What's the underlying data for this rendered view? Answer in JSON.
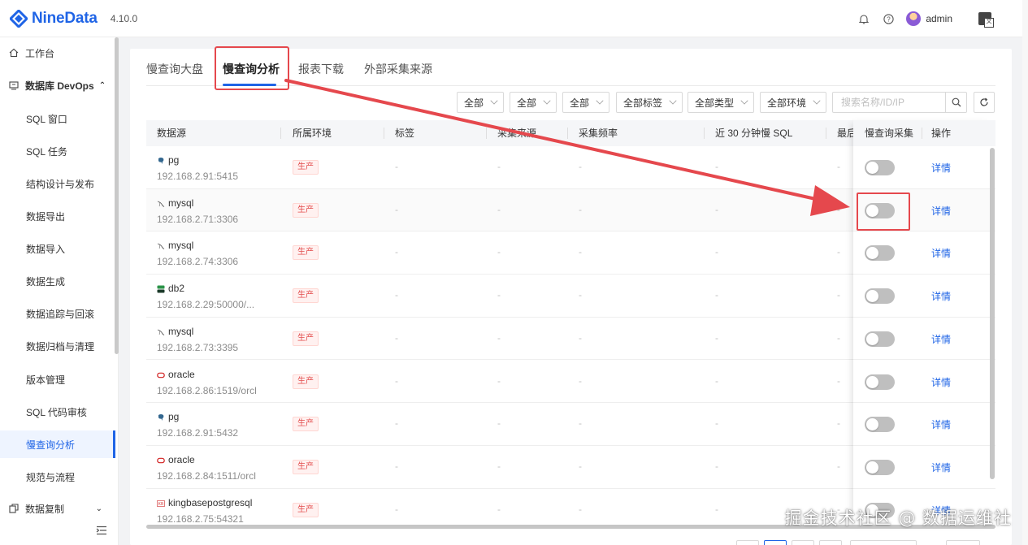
{
  "app": {
    "name": "NineData",
    "version": "4.10.0"
  },
  "header": {
    "user": "admin"
  },
  "sidebar": {
    "items": [
      {
        "label": "工作台",
        "level": "top"
      },
      {
        "label": "数据库 DevOps",
        "level": "group"
      },
      {
        "label": "SQL 窗口",
        "level": "sub"
      },
      {
        "label": "SQL 任务",
        "level": "sub"
      },
      {
        "label": "结构设计与发布",
        "level": "sub"
      },
      {
        "label": "数据导出",
        "level": "sub"
      },
      {
        "label": "数据导入",
        "level": "sub"
      },
      {
        "label": "数据生成",
        "level": "sub"
      },
      {
        "label": "数据追踪与回滚",
        "level": "sub"
      },
      {
        "label": "数据归档与清理",
        "level": "sub"
      },
      {
        "label": "版本管理",
        "level": "sub"
      },
      {
        "label": "SQL 代码审核",
        "level": "sub"
      },
      {
        "label": "慢查询分析",
        "level": "sub",
        "active": true
      },
      {
        "label": "规范与流程",
        "level": "sub"
      },
      {
        "label": "数据复制",
        "level": "top"
      }
    ]
  },
  "tabs": [
    {
      "label": "慢查询大盘"
    },
    {
      "label": "慢查询分析",
      "active": true
    },
    {
      "label": "报表下载"
    },
    {
      "label": "外部采集来源"
    }
  ],
  "filters": {
    "selects": [
      "全部",
      "全部",
      "全部",
      "全部标签",
      "全部类型",
      "全部环境"
    ],
    "search_placeholder": "搜索名称/ID/IP"
  },
  "table": {
    "columns": [
      "数据源",
      "所属环境",
      "标签",
      "采集来源",
      "采集频率",
      "近 30 分钟慢 SQL",
      "最后"
    ],
    "fixed_columns": [
      "慢查询采集",
      "操作"
    ],
    "detail_label": "详情",
    "empty": "-",
    "rows": [
      {
        "type": "pg",
        "name": "pg",
        "addr": "192.168.2.91:5415",
        "env": "生产",
        "collect": false
      },
      {
        "type": "mysql",
        "name": "mysql",
        "addr": "192.168.2.71:3306",
        "env": "生产",
        "collect": false
      },
      {
        "type": "mysql",
        "name": "mysql",
        "addr": "192.168.2.74:3306",
        "env": "生产",
        "collect": false
      },
      {
        "type": "db2",
        "name": "db2",
        "addr": "192.168.2.29:50000/...",
        "env": "生产",
        "collect": false
      },
      {
        "type": "mysql",
        "name": "mysql",
        "addr": "192.168.2.73:3395",
        "env": "生产",
        "collect": false
      },
      {
        "type": "oracle",
        "name": "oracle",
        "addr": "192.168.2.86:1519/orcl",
        "env": "生产",
        "collect": false
      },
      {
        "type": "pg",
        "name": "pg",
        "addr": "192.168.2.91:5432",
        "env": "生产",
        "collect": false
      },
      {
        "type": "oracle",
        "name": "oracle",
        "addr": "192.168.2.84:1511/orcl",
        "env": "生产",
        "collect": false
      },
      {
        "type": "kingbase",
        "name": "kingbasepostgresql",
        "addr": "192.168.2.75:54321",
        "env": "生产",
        "collect": false
      }
    ]
  },
  "icons": {
    "pg": "postgres-elephant-icon",
    "mysql": "mysql-dolphin-icon",
    "db2": "db2-icon",
    "oracle": "oracle-ring-icon",
    "kingbase": "kingbase-icon"
  },
  "colors": {
    "brand": "#1f64e6",
    "annotation": "#e5484d",
    "env_tag": "#e34d4d"
  },
  "watermark": "掘金技术社区 @ 数据运维社"
}
